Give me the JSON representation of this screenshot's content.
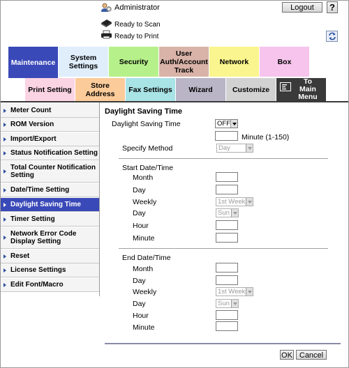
{
  "header": {
    "admin_label": "Administrator",
    "logout_label": "Logout",
    "help_label": "?",
    "status_scan": "Ready to Scan",
    "status_print": "Ready to Print"
  },
  "tabs": [
    {
      "label": "Maintenance",
      "color": "#3a49b8",
      "text_color": "#ffffff"
    },
    {
      "label": "System Settings",
      "color": "#e0eefc",
      "text_color": "#000000"
    },
    {
      "label": "Security",
      "color": "#b6f08a",
      "text_color": "#000000"
    },
    {
      "label": "User Auth/Account Track",
      "color": "#d9b3a8",
      "text_color": "#000000"
    },
    {
      "label": "Network",
      "color": "#faf58e",
      "text_color": "#000000"
    },
    {
      "label": "Box",
      "color": "#f6c4ec",
      "text_color": "#000000"
    }
  ],
  "subtabs": [
    {
      "label": "Print Setting",
      "color": "#fbd4e4"
    },
    {
      "label": "Store Address",
      "color": "#fccb9a"
    },
    {
      "label": "Fax Settings",
      "color": "#a8e3e6"
    },
    {
      "label": "Wizard",
      "color": "#b9b5c6"
    },
    {
      "label": "Customize",
      "color": "#d2d2d2"
    },
    {
      "label": "To Main Menu",
      "color": "#3a3a3a"
    }
  ],
  "sidebar": {
    "items": [
      {
        "label": "Meter Count"
      },
      {
        "label": "ROM Version"
      },
      {
        "label": "Import/Export"
      },
      {
        "label": "Status Notification Setting"
      },
      {
        "label": "Total Counter Notification Setting"
      },
      {
        "label": "Date/Time Setting"
      },
      {
        "label": "Daylight Saving Time"
      },
      {
        "label": "Timer Setting"
      },
      {
        "label": "Network Error Code Display Setting"
      },
      {
        "label": "Reset"
      },
      {
        "label": "License Settings"
      },
      {
        "label": "Edit Font/Macro"
      }
    ],
    "active_index": 6
  },
  "content": {
    "title": "Daylight Saving Time",
    "dst_label": "Daylight Saving Time",
    "dst_value": "OFF",
    "minute_range": "Minute (1-150)",
    "specify_method_label": "Specify Method",
    "specify_method_value": "Day",
    "start": {
      "header": "Start Date/Time",
      "month": "Month",
      "day": "Day",
      "weekly": "Weekly",
      "weekly_value": "1st Week",
      "dow": "Day",
      "dow_value": "Sun",
      "hour": "Hour",
      "minute": "Minute"
    },
    "end": {
      "header": "End Date/Time",
      "month": "Month",
      "day": "Day",
      "weekly": "Weekly",
      "weekly_value": "1st Week",
      "dow": "Day",
      "dow_value": "Sun",
      "hour": "Hour",
      "minute": "Minute"
    },
    "ok_label": "OK",
    "cancel_label": "Cancel"
  }
}
